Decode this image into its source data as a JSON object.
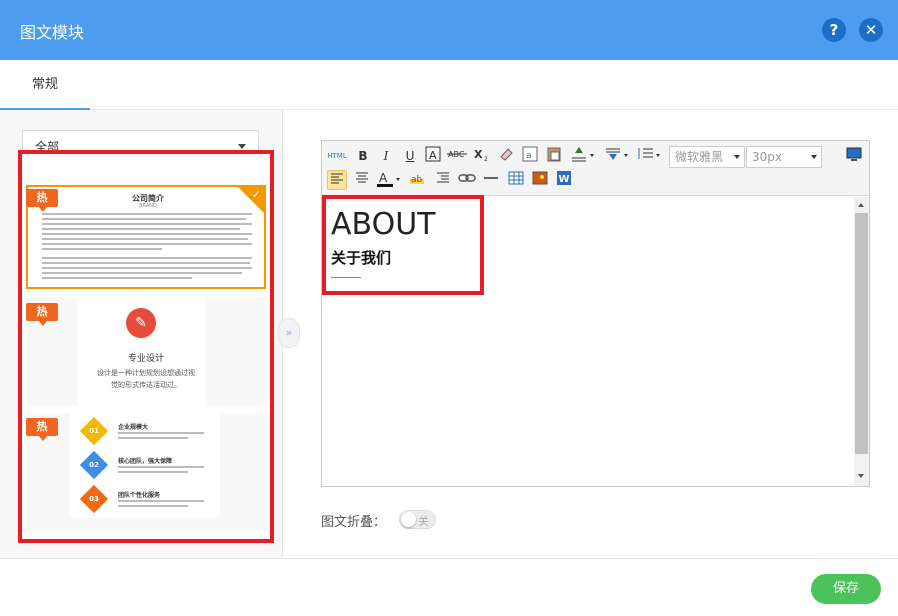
{
  "window": {
    "title": "图文模块",
    "help_icon": "?",
    "close_icon": "✕"
  },
  "tabs": [
    {
      "label": "常规"
    }
  ],
  "left": {
    "filter_select": {
      "value": "全部"
    },
    "hot_badge": "热",
    "templates": [
      {
        "title": "公司简介",
        "subtitle": "BRAND"
      },
      {
        "icon": "edit-icon",
        "title": "专业设计",
        "desc_line1": "设计是一种计划规划设想通过视",
        "desc_line2": "觉的形式传达活动过。"
      },
      {
        "items": [
          {
            "num": "01",
            "title": "企业规模大",
            "color": "#f5b800"
          },
          {
            "num": "02",
            "title": "核心团队，强大保障",
            "color": "#3a8ee6"
          },
          {
            "num": "03",
            "title": "团队个性化服务",
            "color": "#ef6b15"
          }
        ]
      }
    ]
  },
  "collapse_icon": "»",
  "editor": {
    "toolbar": {
      "html": "HTML",
      "bold": "B",
      "italic": "I",
      "underline": "U",
      "font_family": "微软雅黑",
      "font_size": "30px",
      "word_icon": "W"
    },
    "content": {
      "heading": "ABOUT",
      "subheading": "关于我们"
    }
  },
  "fold": {
    "label": "图文折叠：",
    "state": "关"
  },
  "footer": {
    "save_label": "保存"
  }
}
